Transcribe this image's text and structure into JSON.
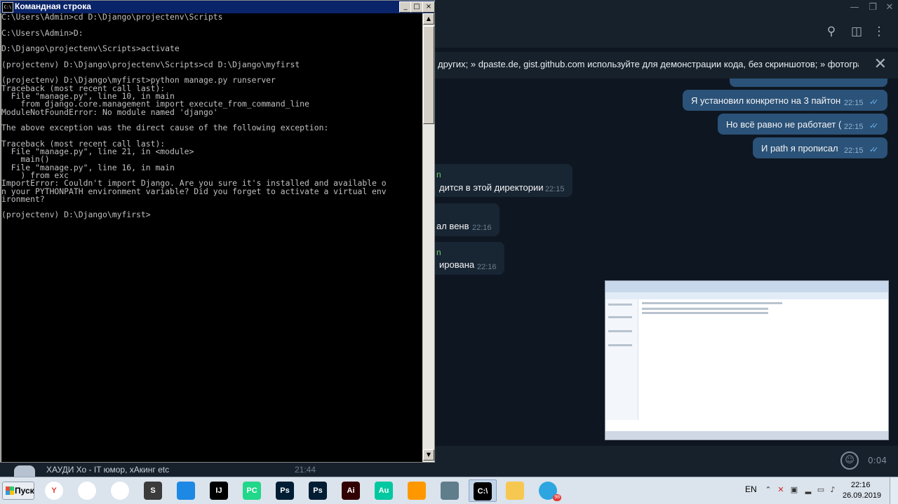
{
  "cmd": {
    "title": "Командная строка",
    "buttons": {
      "minimize": "_",
      "maximize": "□",
      "close": "×"
    },
    "lines": [
      "C:\\Users\\Admin>cd D:\\Django\\projectenv\\Scripts",
      "",
      "C:\\Users\\Admin>D:",
      "",
      "D:\\Django\\projectenv\\Scripts>activate",
      "",
      "(projectenv) D:\\Django\\projectenv\\Scripts>cd D:\\Django\\myfirst",
      "",
      "(projectenv) D:\\Django\\myfirst>python manage.py runserver",
      "Traceback (most recent call last):",
      "  File \"manage.py\", line 10, in main",
      "    from django.core.management import execute_from_command_line",
      "ModuleNotFoundError: No module named 'django'",
      "",
      "The above exception was the direct cause of the following exception:",
      "",
      "Traceback (most recent call last):",
      "  File \"manage.py\", line 21, in <module>",
      "    main()",
      "  File \"manage.py\", line 16, in main",
      "    ) from exc",
      "ImportError: Couldn't import Django. Are you sure it's installed and available o",
      "n your PYTHONPATH environment variable? Did you forget to activate a virtual env",
      "ironment?",
      "",
      "(projectenv) D:\\Django\\myfirst>"
    ]
  },
  "telegram": {
    "pinned_text": "других; » dpaste.de, gist.github.com используйте для демонстрации кода, без скриншотов; » фотограф...",
    "header_icons": [
      "search-icon",
      "sidebar-icon",
      "more-icon"
    ],
    "messages_out": [
      {
        "text": "Я установил конкретно на 3 пайтон",
        "time": "22:15"
      },
      {
        "text": "Но всё равно не работает (",
        "time": "22:15"
      },
      {
        "text": "И path я прописал",
        "time": "22:15"
      }
    ],
    "messages_in": [
      {
        "name": "n",
        "text": "дится в этой директории",
        "time": "22:15"
      },
      {
        "name": "",
        "text": "ал венв",
        "time": "22:16"
      },
      {
        "name": "n",
        "text": "ирована",
        "time": "22:16"
      }
    ],
    "recording_time": "0:04",
    "chat_preview": {
      "text": "ХАУДИ Хо - IT юмор, хАкинг etc",
      "time": "21:44"
    }
  },
  "taskbar": {
    "start_label": "Пуск",
    "apps": [
      {
        "name": "yandex-browser",
        "label": "Y",
        "color": "#ffffff"
      },
      {
        "name": "chrome",
        "label": "",
        "color": "#ffffff"
      },
      {
        "name": "melon",
        "label": "",
        "color": "#ffffff"
      },
      {
        "name": "sublime",
        "label": "S",
        "color": "#3b3b3b"
      },
      {
        "name": "vscode",
        "label": "",
        "color": "#1e88e5"
      },
      {
        "name": "intellij",
        "label": "IJ",
        "color": "#000000"
      },
      {
        "name": "pycharm",
        "label": "PC",
        "color": "#21d789"
      },
      {
        "name": "photoshop-1",
        "label": "Ps",
        "color": "#001d34"
      },
      {
        "name": "photoshop-2",
        "label": "Ps",
        "color": "#001d34"
      },
      {
        "name": "illustrator",
        "label": "Ai",
        "color": "#310000"
      },
      {
        "name": "audition",
        "label": "Au",
        "color": "#00c8a0"
      },
      {
        "name": "headphones",
        "label": "",
        "color": "#ff9800"
      },
      {
        "name": "media-player",
        "label": "",
        "color": "#607d8b"
      },
      {
        "name": "cmd",
        "label": "C:\\",
        "color": "#000000"
      },
      {
        "name": "explorer",
        "label": "",
        "color": "#f6c851"
      },
      {
        "name": "telegram",
        "label": "",
        "color": "#2ca5e0"
      }
    ],
    "telegram_badge": "98",
    "lang": "EN",
    "time": "22:16",
    "date": "26.09.2019"
  }
}
